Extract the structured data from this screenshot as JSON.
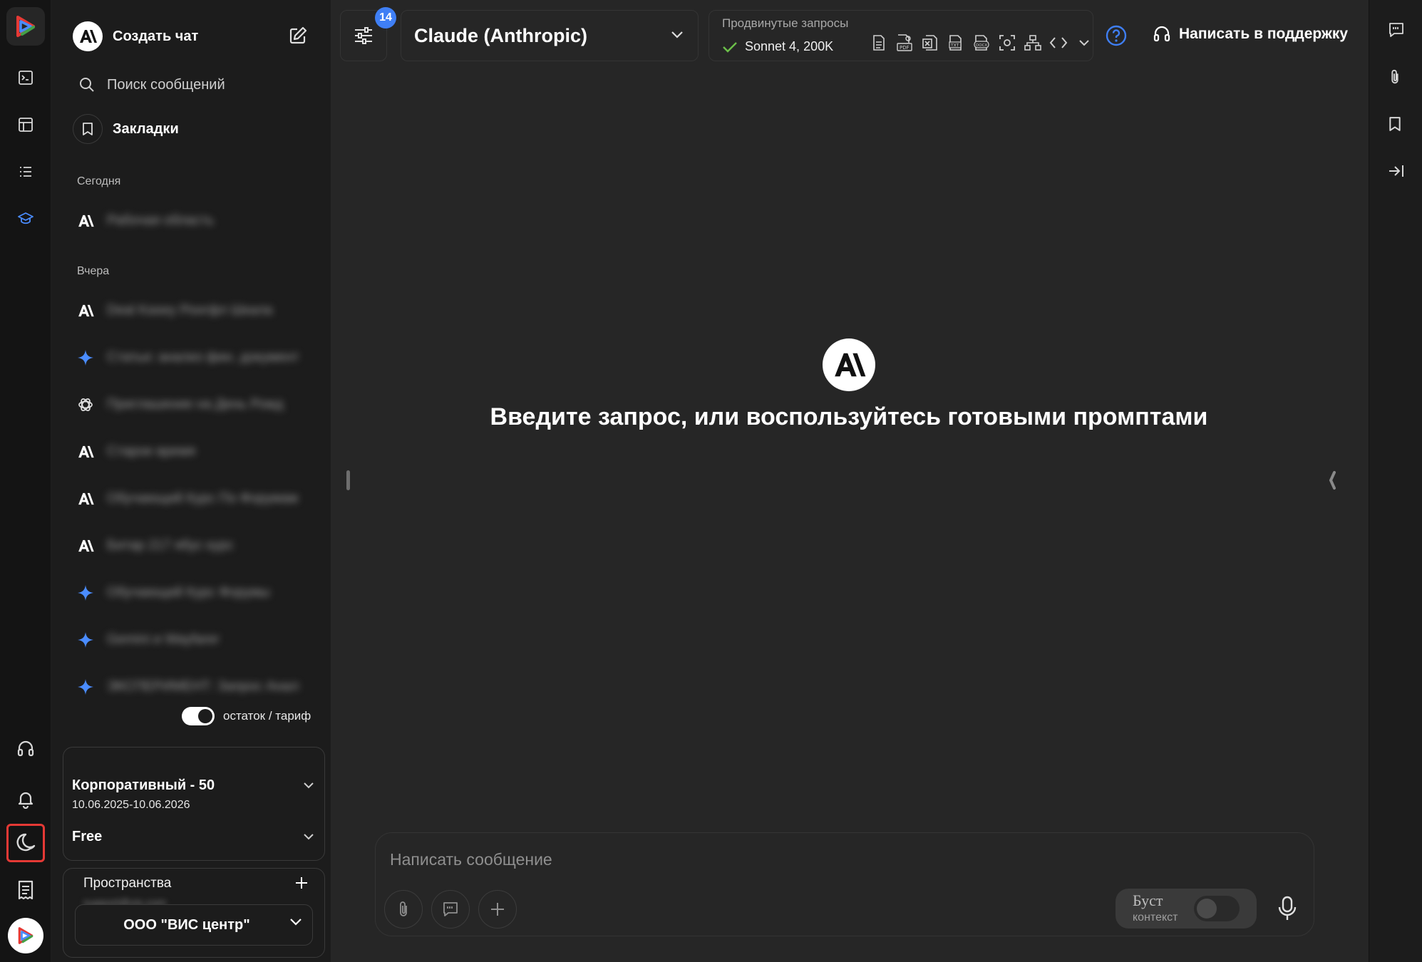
{
  "rail": {
    "items": [
      "terminal-icon",
      "table-icon",
      "list-icon",
      "graduation-cap-icon"
    ],
    "bottom_items": [
      "headset-icon",
      "bell-icon",
      "moon-icon",
      "receipt-icon"
    ],
    "active_color": "#4a8cff",
    "highlight_color": "#e53935"
  },
  "sidebar": {
    "new_chat_label": "Создать чат",
    "search_placeholder": "Поиск сообщений",
    "bookmarks_label": "Закладки",
    "groups": [
      {
        "label": "Сегодня",
        "items": [
          {
            "icon": "anthropic-icon",
            "title": "Рабочая область"
          }
        ]
      },
      {
        "label": "Вчера",
        "items": [
          {
            "icon": "anthropic-icon",
            "title": "Deal Kasey Ронгфл Шкала"
          },
          {
            "icon": "gemini-icon",
            "title": "Статьи: анализ фин. документов"
          },
          {
            "icon": "openai-icon",
            "title": "Приглашение на День Рожд"
          },
          {
            "icon": "anthropic-icon",
            "title": "Старое время"
          },
          {
            "icon": "anthropic-icon",
            "title": "Обучающий Курс По Форумам"
          },
          {
            "icon": "anthropic-icon",
            "title": "Битар 217 ябус курс"
          },
          {
            "icon": "gemini-icon",
            "title": "Обучающий Курс Форумы"
          },
          {
            "icon": "gemini-icon",
            "title": "Gemini и Wayfarer"
          },
          {
            "icon": "gemini-icon",
            "title": "ЭКСПЕРИМЕНТ: Запрос Анализ"
          }
        ]
      }
    ],
    "toggle_label": "остаток / тариф",
    "toggle_on": true,
    "plan_name": "Корпоративный - 50",
    "plan_dates": "10.06.2025-10.06.2026",
    "plan_tier": "Free",
    "spaces_title": "Пространства",
    "spaces_email": "support@vis.com",
    "spaces_selected": "ООО \"ВИС центр\""
  },
  "topbar": {
    "settings_badge": "14",
    "model_name": "Claude (Anthropic)",
    "advanced_label": "Продвинутые запросы",
    "advanced_model": "Sonnet 4, 200K",
    "file_icons": [
      "doc-icon",
      "pdf-icon",
      "excel-icon",
      "txt-icon",
      "docx-icon",
      "scan-icon",
      "diagram-icon",
      "code-icon"
    ],
    "support_label": "Написать в поддержку",
    "accent": "#3f7ff5",
    "check_color": "#6cc04a"
  },
  "main": {
    "hero_text": "Введите запрос, или воспользуйтесь готовыми промптами"
  },
  "composer": {
    "placeholder": "Написать сообщение",
    "boost_title": "Буст",
    "boost_subtitle": "контекст",
    "boost_on": false
  }
}
